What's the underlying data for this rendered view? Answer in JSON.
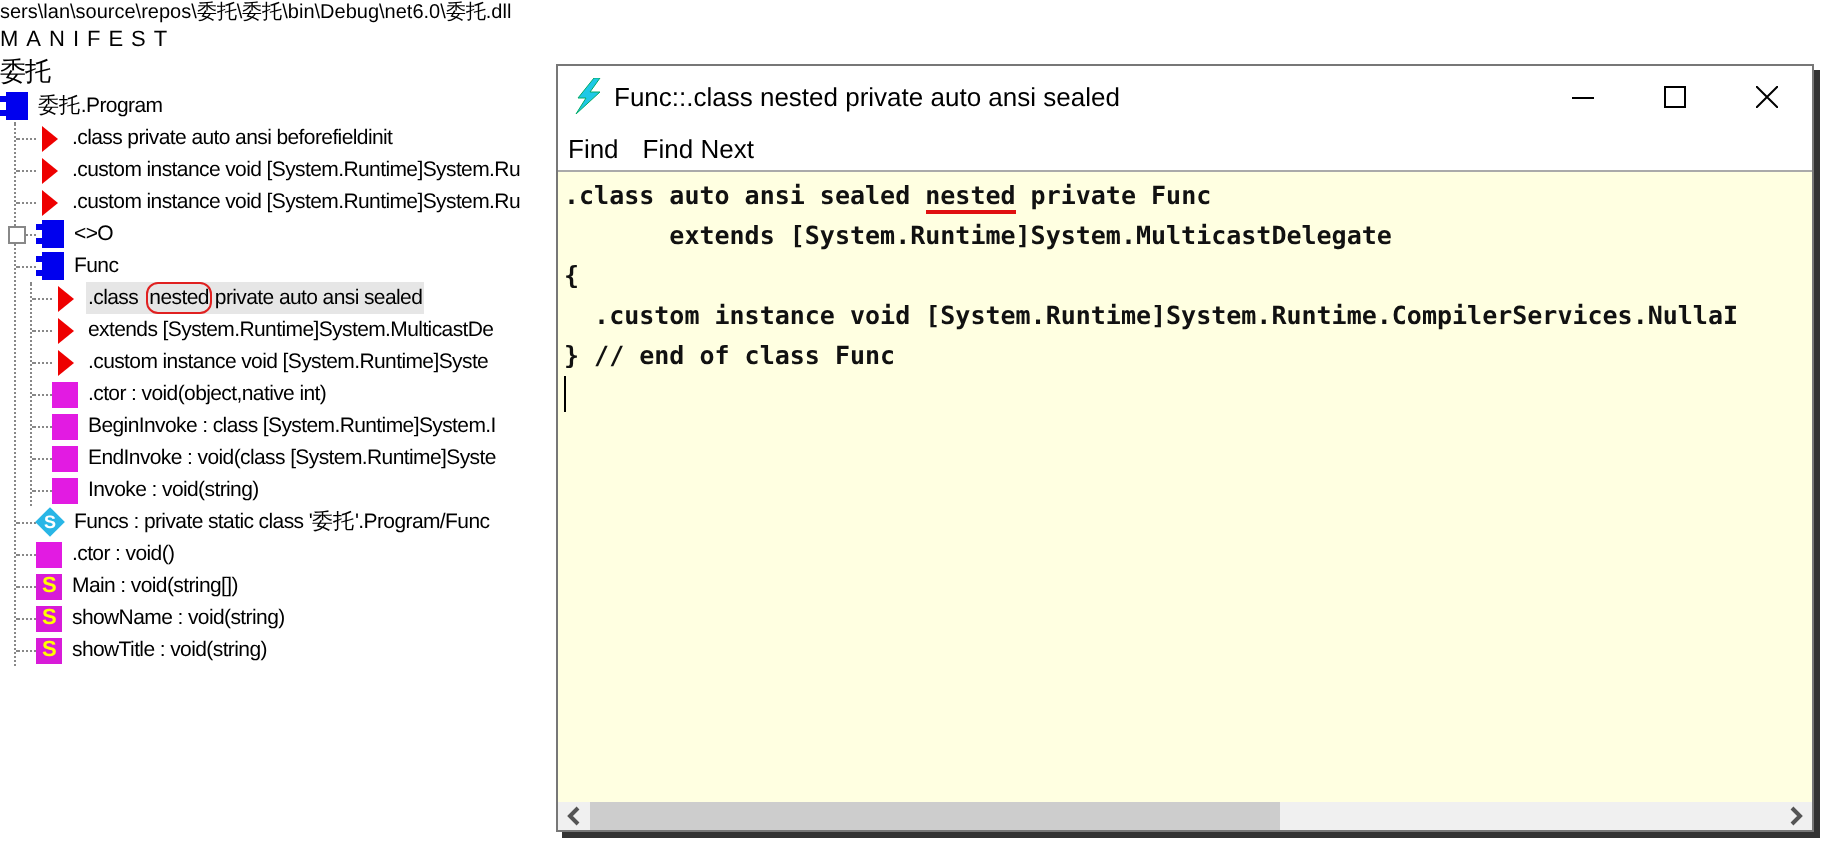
{
  "path_line": "sers\\lan\\source\\repos\\委托\\委托\\bin\\Debug\\net6.0\\委托.dll",
  "manifest": "MANIFEST",
  "tree": {
    "label": "委托",
    "children": [
      {
        "kind": "class",
        "label": "委托.Program",
        "expanded": true,
        "children": [
          {
            "kind": "directive",
            "label": ".class private auto ansi beforefieldinit"
          },
          {
            "kind": "directive",
            "label": ".custom instance void [System.Runtime]System.Ru"
          },
          {
            "kind": "directive",
            "label": ".custom instance void [System.Runtime]System.Ru"
          },
          {
            "kind": "class",
            "label": "<>O",
            "expanded": false
          },
          {
            "kind": "class",
            "label": "Func",
            "expanded": true,
            "children": [
              {
                "kind": "directive",
                "label": ".class",
                "circled": "nested",
                "label_after": "private auto ansi sealed",
                "selected": true
              },
              {
                "kind": "directive",
                "label": "extends [System.Runtime]System.MulticastDe",
                "selected": false
              },
              {
                "kind": "directive",
                "label": ".custom instance void [System.Runtime]Syste",
                "selected": false
              },
              {
                "kind": "method",
                "label": ".ctor : void(object,native int)"
              },
              {
                "kind": "method",
                "label": "BeginInvoke : class [System.Runtime]System.I"
              },
              {
                "kind": "method",
                "label": "EndInvoke : void(class [System.Runtime]Syste"
              },
              {
                "kind": "method",
                "label": "Invoke : void(string)"
              }
            ]
          },
          {
            "kind": "field",
            "badge": "S",
            "label": "Funcs : private static class '委托'.Program/Func"
          },
          {
            "kind": "method",
            "label": ".ctor : void()"
          },
          {
            "kind": "static",
            "badge": "S",
            "label": "Main : void(string[])"
          },
          {
            "kind": "static",
            "badge": "S",
            "label": "showName : void(string)"
          },
          {
            "kind": "static",
            "badge": "S",
            "label": "showTitle : void(string)"
          }
        ]
      }
    ]
  },
  "window": {
    "title": "Func::.class nested private auto ansi sealed",
    "menu": [
      "Find",
      "Find Next"
    ],
    "code": [
      {
        "text": ".class auto ansi sealed ",
        "underlined": "nested",
        "text_after": " private Func"
      },
      {
        "text": "       extends [System.Runtime]System.MulticastDelegate"
      },
      {
        "text": "{"
      },
      {
        "text": "  .custom instance void [System.Runtime]System.Runtime.CompilerServices.NullaI"
      },
      {
        "text": "} // end of class Func"
      }
    ]
  }
}
